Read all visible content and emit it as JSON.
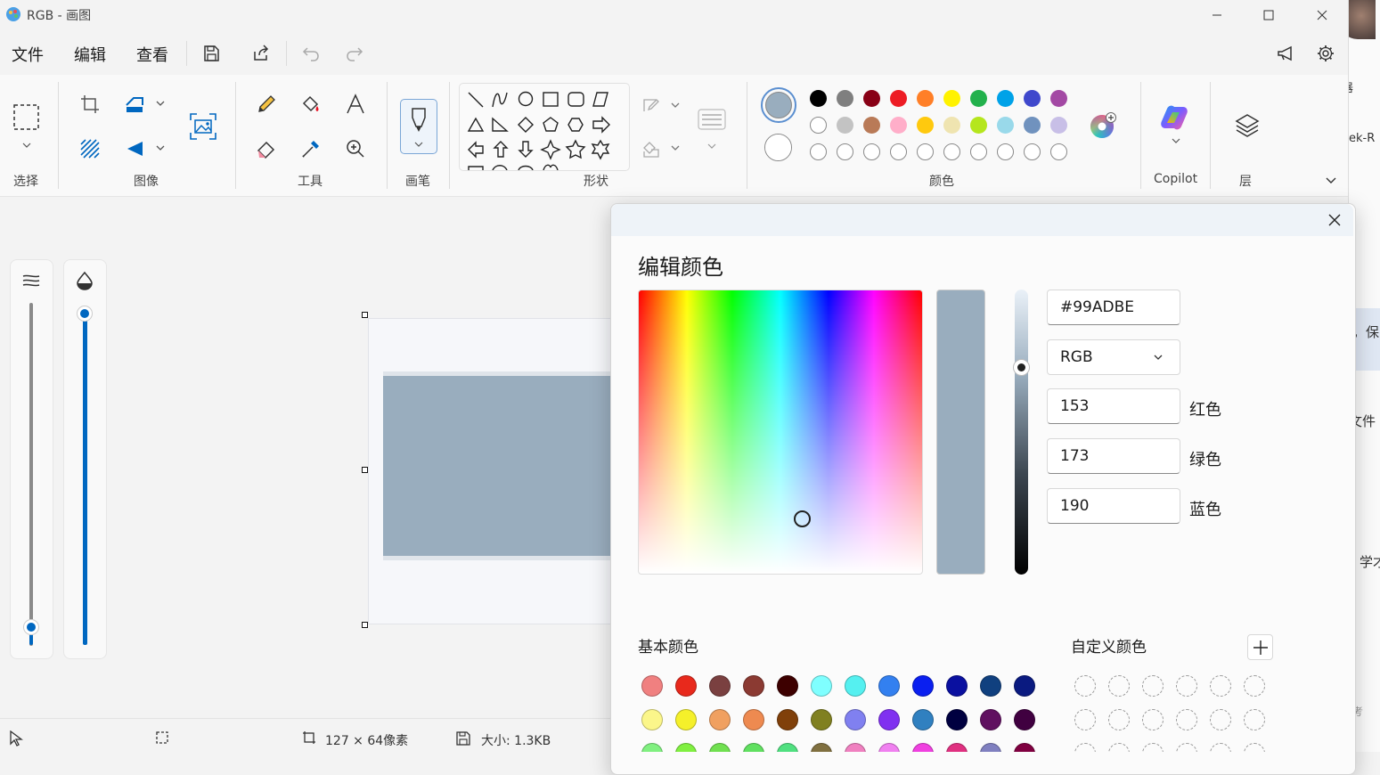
{
  "window": {
    "title": "RGB - 画图"
  },
  "menu": {
    "file": "文件",
    "edit": "编辑",
    "view": "查看"
  },
  "ribbon": {
    "groups": {
      "select": "选择",
      "image": "图像",
      "tools": "工具",
      "brush": "画笔",
      "shapes": "形状",
      "colors": "颜色",
      "copilot": "Copilot",
      "layers": "层"
    },
    "primary_color": "#99ADBE",
    "secondary_color": "#FFFFFF",
    "palette_row1": [
      "#000000",
      "#7f7f7f",
      "#880015",
      "#ed1c24",
      "#ff7f27",
      "#fff200",
      "#22b14c",
      "#00a2e8",
      "#3f48cc",
      "#a349a4"
    ],
    "palette_row2": [
      "#ffffff",
      "#c3c3c3",
      "#b97a57",
      "#ffaec9",
      "#ffc90e",
      "#efe4b0",
      "#b5e61d",
      "#99d9ea",
      "#7092be",
      "#c8bfe7"
    ]
  },
  "canvas": {
    "fill_color": "#99ADBE"
  },
  "status": {
    "dimensions": "127 × 64像素",
    "size": "大小: 1.3KB"
  },
  "dialog": {
    "title": "编辑颜色",
    "hex": "#99ADBE",
    "mode": "RGB",
    "red": "153",
    "green": "173",
    "blue": "190",
    "red_label": "红色",
    "green_label": "绿色",
    "blue_label": "蓝色",
    "basic_colors_label": "基本颜色",
    "custom_colors_label": "自定义颜色",
    "basic_colors": [
      [
        "#f08080",
        "#e8291c",
        "#7a4040",
        "#8b3a32",
        "#3d0000",
        "#7fffff",
        "#55f0f0",
        "#3380f0",
        "#0a1ff0",
        "#0a10a0",
        "#10407f",
        "#0a1a80"
      ],
      [
        "#fbf68a",
        "#f5f02a",
        "#f0a060",
        "#ee8a50",
        "#80400a",
        "#808020",
        "#8080f0",
        "#8030f0",
        "#3080c0",
        "#000040",
        "#601060",
        "#400040"
      ],
      [
        "#80f080",
        "#80f040",
        "#70e050",
        "#60e060",
        "#50e080",
        "#807040",
        "#f080c0",
        "#f080f0",
        "#f040e0",
        "#e03080",
        "#8080c0",
        "#800040"
      ]
    ]
  },
  "background_window": {
    "t1": "器",
    "t2": "ek-R",
    "t3": "，保",
    "t4": "文件",
    "t5": "学才",
    "t6": "考"
  }
}
